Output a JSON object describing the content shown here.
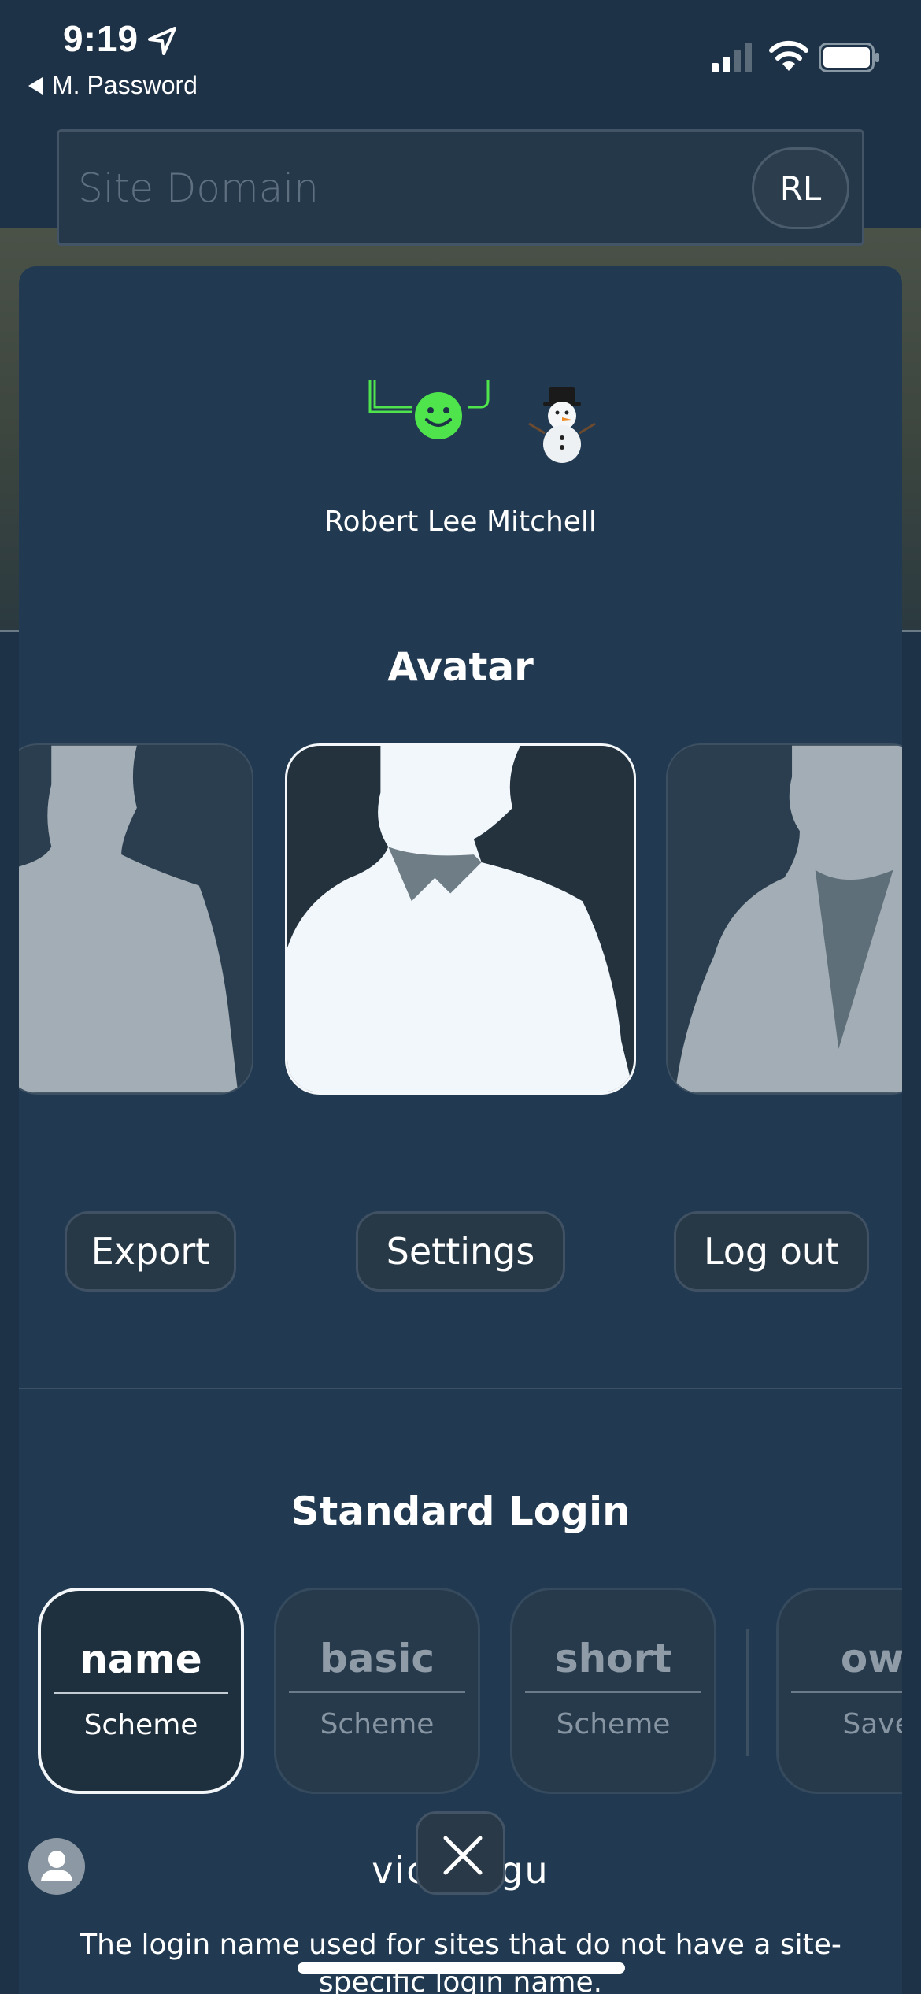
{
  "status_bar": {
    "time": "9:19",
    "back_label": "M. Password"
  },
  "domain_bar": {
    "placeholder": "Site Domain",
    "user_initials": "RL"
  },
  "profile": {
    "full_name": "Robert Lee Mitchell",
    "identicon_color": "#4fe34c"
  },
  "avatar_section": {
    "title": "Avatar"
  },
  "actions": {
    "export": "Export",
    "settings": "Settings",
    "logout": "Log out"
  },
  "login_section": {
    "title": "Standard Login",
    "schemes": [
      {
        "name": "name",
        "sub": "Scheme",
        "selected": true
      },
      {
        "name": "basic",
        "sub": "Scheme",
        "selected": false
      },
      {
        "name": "short",
        "sub": "Scheme",
        "selected": false
      },
      {
        "name": "own",
        "sub": "Saved",
        "selected": false
      }
    ],
    "login_value": "vicebegu",
    "description": "The login name used for sites that do not have a site-specific login name."
  }
}
